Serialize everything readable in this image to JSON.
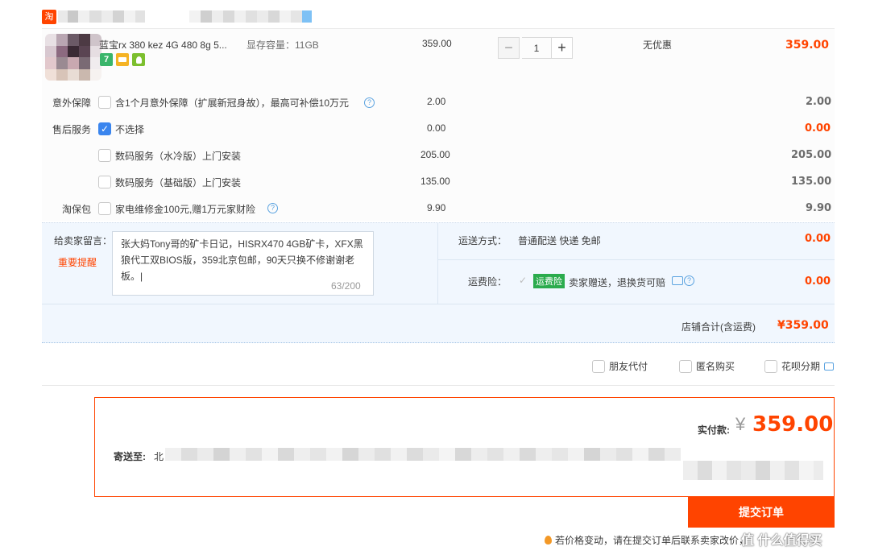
{
  "shop": {
    "logo_text": "淘",
    "logo_color": "#ff4400",
    "name_redacted": true
  },
  "item": {
    "title": "蓝宝rx 380 kez 4G 480 8g 5...",
    "spec": "显存容量：11GB",
    "unit_price": "359.00",
    "quantity": "1",
    "discount": "无优惠",
    "subtotal": "359.00",
    "badges": [
      "7",
      "card-icon",
      "leaf-icon"
    ]
  },
  "services": {
    "accident": {
      "label": "意外保障",
      "option": "含1个月意外保障（扩展新冠身故），最高可补偿10万元",
      "price": "2.00",
      "total": "2.00"
    },
    "aftersale": {
      "label": "售后服务",
      "options": [
        {
          "text": "不选择",
          "price": "0.00",
          "total": "0.00",
          "checked": true
        },
        {
          "text": "数码服务（水冷版）上门安装",
          "price": "205.00",
          "total": "205.00",
          "checked": false
        },
        {
          "text": "数码服务（基础版）上门安装",
          "price": "135.00",
          "total": "135.00",
          "checked": false
        }
      ]
    },
    "taobaobao": {
      "label": "淘保包",
      "option": "家电维修金100元,赠1万元家财险",
      "price": "9.90",
      "total": "9.90"
    }
  },
  "message": {
    "label": "给卖家留言：",
    "reminder": "重要提醒",
    "text": "张大妈Tony哥的矿卡日记，HISRX470 4GB矿卡，XFX黑狼代工双BIOS版，359北京包邮，90天只换不修谢谢老板。|",
    "count": "63/200"
  },
  "shipping": {
    "method_label": "运送方式：",
    "method_value": "普通配送 快递 免邮",
    "method_price": "0.00",
    "insurance_label": "运费险：",
    "insurance_badge": "运费险",
    "insurance_text": "卖家赠送，退换货可赔",
    "insurance_price": "0.00"
  },
  "store_total": {
    "label": "店铺合计(含运费)",
    "value": "¥359.00"
  },
  "options": {
    "friend_pay": "朋友代付",
    "anonymous": "匿名购买",
    "huabei": "花呗分期"
  },
  "payment": {
    "label": "实付款:",
    "currency": "¥",
    "amount": "359.00",
    "address_label": "寄送至:",
    "address_prefix": "北"
  },
  "submit": {
    "label": "提交订单"
  },
  "notice": {
    "text": "若价格变动，请在提交订单后联系卖家改价，"
  },
  "watermark": {
    "text": "值 什么值得买"
  },
  "colors": {
    "accent": "#ff4400",
    "checkbox_blue": "#3a85ee",
    "panel_blue": "#f1f7fe",
    "freight_green": "#2bab4d"
  }
}
